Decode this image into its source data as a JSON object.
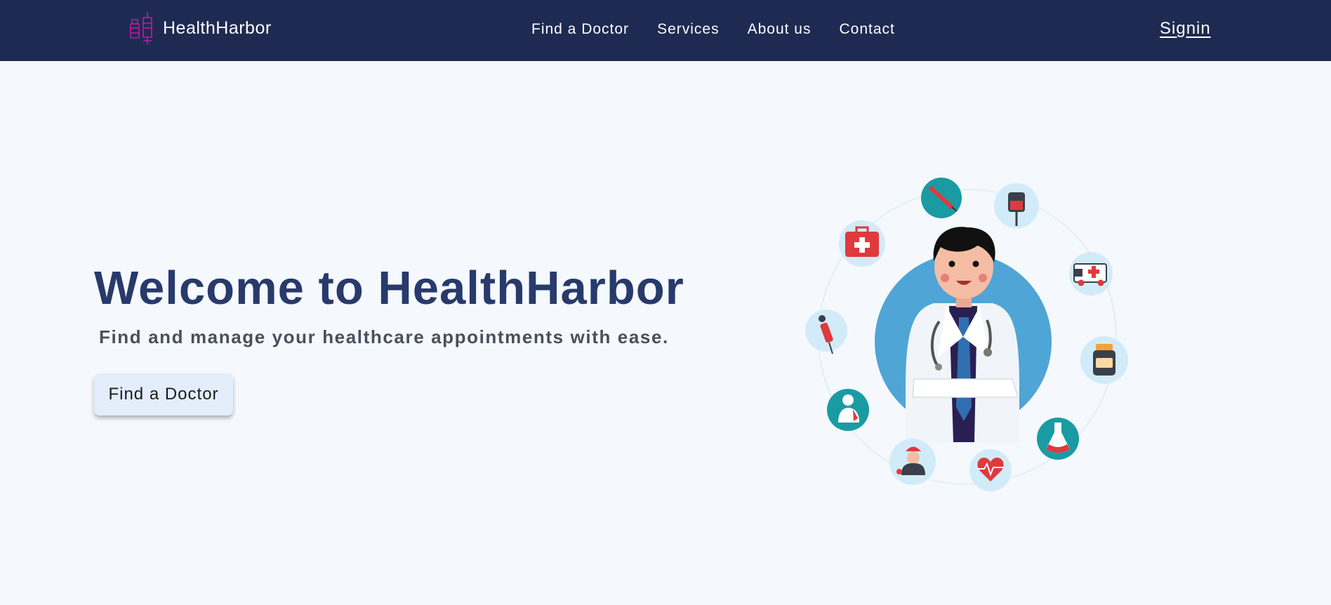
{
  "brand": {
    "name": "HealthHarbor",
    "logo_icon": "medicine-bottles-logo-icon",
    "logo_color": "#c0199f"
  },
  "nav": {
    "links": [
      {
        "label": "Find a Doctor"
      },
      {
        "label": "Services"
      },
      {
        "label": "About us"
      },
      {
        "label": "Contact"
      }
    ],
    "signin_label": "Signin"
  },
  "hero": {
    "title": "Welcome to HealthHarbor",
    "subtitle": "Find and manage your healthcare appointments with ease.",
    "cta_label": "Find a Doctor"
  },
  "illustration": {
    "subject": "doctor-character",
    "icons": [
      "syringe-icon",
      "iv-bag-icon",
      "ambulance-icon",
      "pill-bottle-icon",
      "flask-icon",
      "heart-rate-icon",
      "nurse-icon",
      "patient-icon",
      "dropper-icon",
      "first-aid-kit-icon"
    ]
  },
  "colors": {
    "navbar": "#1f2a52",
    "background": "#f5f9fe",
    "title": "#283a6b",
    "button": "#e3edfb",
    "accent_teal": "#1a9ba3",
    "accent_light_blue": "#d2ebf9",
    "accent_red": "#e0393e",
    "circle_blue": "#4fa5d6"
  }
}
